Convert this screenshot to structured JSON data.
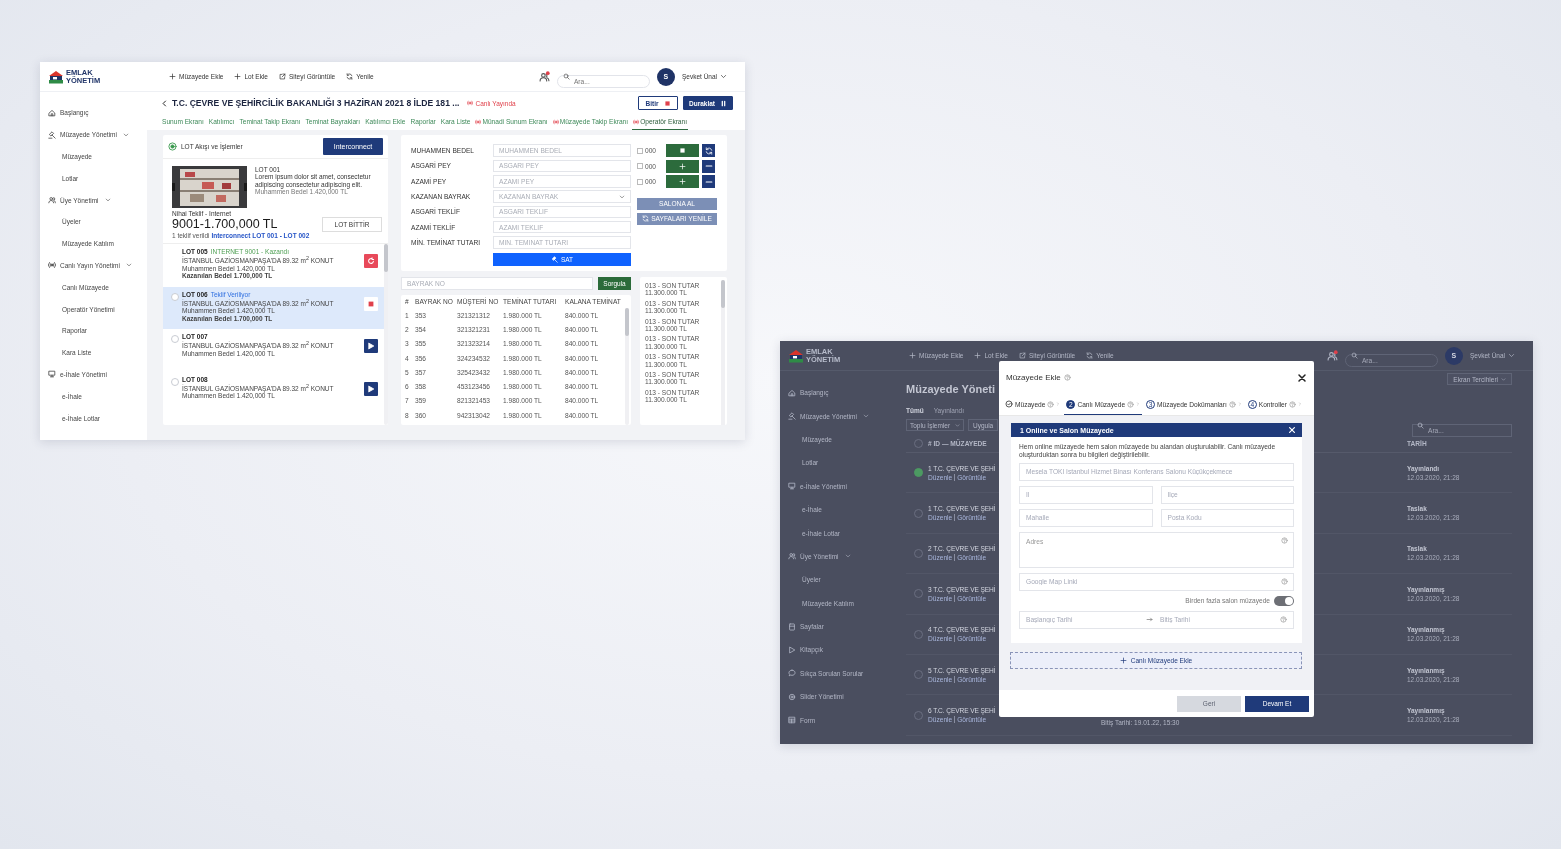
{
  "operator_screen": {
    "logo": {
      "line1": "EMLAK",
      "line2": "YÖNETİM"
    },
    "toolbar": [
      {
        "label": "Müzayede Ekle"
      },
      {
        "label": "Lot Ekle"
      },
      {
        "label": "Siteyi Görüntüle"
      },
      {
        "label": "Yenile"
      }
    ],
    "notifications": {
      "unread": true
    },
    "search": {
      "placeholder": "Ara..."
    },
    "user": {
      "initial": "S",
      "name": "Şevket Ünal"
    },
    "sidebar": [
      {
        "label": "Başlangıç"
      },
      {
        "label": "Müzayede Yönetimi",
        "expanded": true,
        "children": [
          {
            "label": "Müzayede"
          },
          {
            "label": "Lotlar"
          }
        ]
      },
      {
        "label": "Üye Yönetimi",
        "expanded": true,
        "children": [
          {
            "label": "Üyeler"
          },
          {
            "label": "Müzayede Katılım"
          }
        ]
      },
      {
        "label": "Canlı Yayın Yönetimi",
        "expanded": true,
        "children": [
          {
            "label": "Canlı Müzayede"
          },
          {
            "label": "Operatör Yönetimi"
          },
          {
            "label": "Raporlar"
          },
          {
            "label": "Kara Liste"
          }
        ]
      },
      {
        "label": "e-İhale Yönetimi",
        "children": [
          {
            "label": "e-İhale"
          },
          {
            "label": "e-İhale Lotlar"
          }
        ]
      }
    ],
    "title": "T.C. ÇEVRE VE ŞEHİRCİLİK BAKANLIĞI 3 HAZİRAN 2021 8 İLDE 181 ...",
    "live_badge": "Canlı Yayında",
    "actions": [
      {
        "label": "Bitir",
        "kind": "stop"
      },
      {
        "label": "Duraklat",
        "kind": "pause"
      }
    ],
    "tabs": [
      {
        "label": "Sunum Ekranı",
        "live": false,
        "selected": false
      },
      {
        "label": "Katılımcı",
        "live": false,
        "selected": false
      },
      {
        "label": "Teminat Takip Ekranı",
        "live": false,
        "selected": false
      },
      {
        "label": "Teminat Bayrakları",
        "live": false,
        "selected": false
      },
      {
        "label": "Katılımcı Ekle",
        "live": false,
        "selected": false
      },
      {
        "label": "Raporlar",
        "live": false,
        "selected": false
      },
      {
        "label": "Kara Liste",
        "live": false,
        "selected": false
      },
      {
        "label": "Münadi Sunum Ekranı",
        "live": true,
        "selected": false
      },
      {
        "label": "Müzayede Takip Ekranı",
        "live": true,
        "selected": false
      },
      {
        "label": "Operatör Ekranı",
        "live": true,
        "selected": true
      }
    ],
    "lot_panel": {
      "title": "LOT Akışı ve İşlemler",
      "button": "Interconnect",
      "current": {
        "lot": "LOT 001",
        "description": "Lorem ipsum dolor sit amet, consectetur adipiscing consectetur adipiscing elit.",
        "estimate": "Muhammen Bedel 1.420,000 TL",
        "final_label": "Nihai Teklif - Internet",
        "final_value": "9001-1.700,000 TL",
        "bids": "1 teklif verildi **Interconnect LOT 001 - LOT 002**",
        "finish_button": "LOT BİTTİR"
      },
      "lots": [
        {
          "lot": "LOT 005",
          "kind": "won",
          "status": "INTERNET 9001 - Kazandı",
          "selected": false,
          "address": "İSTANBUL GAZİOSMANPAŞA'DA 89.32 m$^{2}$ KONUT",
          "estimate": "Muhammen Bedel 1.420,000 TL",
          "won_price": "Kazanılan Bedel 1.700,000 TL"
        },
        {
          "lot": "LOT 006",
          "kind": "bidding",
          "status": "Teklif Veriliyor",
          "selected": true,
          "address": "İSTANBUL GAZİOSMANPAŞA'DA 89.32 m$^{2}$ KONUT",
          "estimate": "Muhammen Bedel 1.420,000 TL",
          "won_price": "Kazanılan Bedel 1.700,000 TL"
        },
        {
          "lot": "LOT 007",
          "kind": "pending",
          "selected": false,
          "address": "İSTANBUL GAZİOSMANPAŞA'DA 89.32 m$^{2}$ KONUT",
          "estimate": "Muhammen Bedel 1.420,000 TL"
        },
        {
          "lot": "LOT 008",
          "kind": "pending",
          "selected": false,
          "address": "İSTANBUL GAZİOSMANPAŞA'DA 89.32 m$^{2}$ KONUT",
          "estimate": "Muhammen Bedel 1.420,000 TL"
        }
      ]
    },
    "bid_form": {
      "fields": [
        {
          "label": "MUHAMMEN BEDEL",
          "kind": "text",
          "placeholder": "MUHAMMEN BEDEL"
        },
        {
          "label": "ASGARİ PEY",
          "kind": "text",
          "placeholder": "ASGARİ PEY"
        },
        {
          "label": "AZAMİ PEY",
          "kind": "text",
          "placeholder": "AZAMİ PEY"
        },
        {
          "label": "KAZANAN BAYRAK",
          "kind": "select",
          "placeholder": "KAZANAN BAYRAK"
        },
        {
          "label": "ASGARİ TEKLİF",
          "kind": "text",
          "placeholder": "ASGARİ TEKLİF"
        },
        {
          "label": "AZAMİ TEKLİF",
          "kind": "text",
          "placeholder": "AZAMİ TEKLİF"
        },
        {
          "label": "MİN. TEMİNAT TUTARI",
          "kind": "text",
          "placeholder": "MİN. TEMİNAT TUTARI"
        }
      ],
      "submit": "SAT",
      "controls": [
        {
          "label": "000",
          "checked": false
        },
        {
          "label": "000",
          "checked": false
        },
        {
          "label": "000",
          "checked": false
        }
      ],
      "buttons": [
        "SALONA AL",
        "SAYFALARI YENİLE"
      ]
    },
    "flag_search": {
      "placeholder": "BAYRAK NO",
      "button": "Sorgula"
    },
    "table": {
      "columns": [
        "#",
        "BAYRAK NO",
        "MÜŞTERİ NO",
        "TEMİNAT TUTARI",
        "KALANA TEMİNAT"
      ],
      "rows": [
        [
          "1",
          "353",
          "321321312",
          "1.980.000 TL",
          "840.000 TL"
        ],
        [
          "2",
          "354",
          "321321231",
          "1.980.000 TL",
          "840.000 TL"
        ],
        [
          "3",
          "355",
          "321323214",
          "1.980.000 TL",
          "840.000 TL"
        ],
        [
          "4",
          "356",
          "324234532",
          "1.980.000 TL",
          "840.000 TL"
        ],
        [
          "5",
          "357",
          "325423432",
          "1.980.000 TL",
          "840.000 TL"
        ],
        [
          "6",
          "358",
          "453123456",
          "1.980.000 TL",
          "840.000 TL"
        ],
        [
          "7",
          "359",
          "821321453",
          "1.980.000 TL",
          "840.000 TL"
        ],
        [
          "8",
          "360",
          "942313042",
          "1.980.000 TL",
          "840.000 TL"
        ]
      ]
    },
    "price_list": [
      {
        "label": "013 - SON TUTAR",
        "value": "11.300.000 TL"
      },
      {
        "label": "013 - SON TUTAR",
        "value": "11.300.000 TL"
      },
      {
        "label": "013 - SON TUTAR",
        "value": "11.300.000 TL"
      },
      {
        "label": "013 - SON TUTAR",
        "value": "11.300.000 TL"
      },
      {
        "label": "013 - SON TUTAR",
        "value": "11.300.000 TL"
      },
      {
        "label": "013 - SON TUTAR",
        "value": "11.300.000 TL"
      },
      {
        "label": "013 - SON TUTAR",
        "value": "11.300.000 TL"
      }
    ]
  },
  "auction_list_screen": {
    "logo": {
      "line1": "EMLAK",
      "line2": "YÖNETİM"
    },
    "toolbar": [
      {
        "label": "Müzayede Ekle"
      },
      {
        "label": "Lot Ekle"
      },
      {
        "label": "Siteyi Görüntüle"
      },
      {
        "label": "Yenile"
      }
    ],
    "notifications": {
      "unread": true
    },
    "search": {
      "placeholder": "Ara..."
    },
    "user": {
      "initial": "S",
      "name": "Şevket Ünal"
    },
    "sidebar": [
      {
        "label": "Başlangıç"
      },
      {
        "label": "Müzayede Yönetimi",
        "expanded": true,
        "children": [
          {
            "label": "Müzayede"
          },
          {
            "label": "Lotlar"
          }
        ]
      },
      {
        "label": "e-İhale Yönetimi",
        "children": [
          {
            "label": "e-İhale"
          },
          {
            "label": "e-İhale Lotlar"
          }
        ]
      },
      {
        "label": "Üye Yönetimi",
        "expanded": true,
        "children": [
          {
            "label": "Üyeler"
          },
          {
            "label": "Müzayede Katılım"
          }
        ]
      },
      {
        "label": "Sayfalar"
      },
      {
        "label": "Kitapçık"
      },
      {
        "label": "Sıkça Sorulan Sorular"
      },
      {
        "label": "Slider Yönetimi"
      },
      {
        "label": "Form"
      }
    ],
    "title": "Müzayede Yöneti",
    "view_button": "Ekran Tercihleri",
    "filters": [
      {
        "label": "Tümü",
        "selected": true
      },
      {
        "label": "Yayınlandı",
        "selected": false
      }
    ],
    "bulk_action": {
      "placeholder": "Toplu İşlemler"
    },
    "apply_button": "Uygula",
    "table_search": {
      "placeholder": "Ara..."
    },
    "select_all": {
      "checked": false
    },
    "columns": [
      "# ID — MÜZAYEDE",
      "TARİH"
    ],
    "rows": [
      {
        "number": "1",
        "title": "T.C. ÇEVRE VE ŞEHİ",
        "links": [
          "Düzenle",
          "Görüntüle"
        ],
        "status": "Yayınlandı",
        "date": "12.03.2020, 21:28",
        "selected": true
      },
      {
        "number": "1",
        "title": "T.C. ÇEVRE VE ŞEHİ",
        "links": [
          "Düzenle",
          "Görüntüle"
        ],
        "status": "Taslak",
        "date": "12.03.2020, 21:28",
        "selected": false
      },
      {
        "number": "2",
        "title": "T.C. ÇEVRE VE ŞEHİ",
        "links": [
          "Düzenle",
          "Görüntüle"
        ],
        "status": "Taslak",
        "date": "12.03.2020, 21:28",
        "selected": false
      },
      {
        "number": "3",
        "title": "T.C. ÇEVRE VE ŞEHİ",
        "links": [
          "Düzenle",
          "Görüntüle"
        ],
        "status": "Yayınlanmış",
        "date": "12.03.2020, 21:28",
        "selected": false
      },
      {
        "number": "4",
        "title": "T.C. ÇEVRE VE ŞEHİ",
        "links": [
          "Düzenle",
          "Görüntüle"
        ],
        "status": "Yayınlanmış",
        "date": "12.03.2020, 21:28",
        "selected": false
      },
      {
        "number": "5",
        "title": "T.C. ÇEVRE VE ŞEHİ",
        "links": [
          "Düzenle",
          "Görüntüle"
        ],
        "status": "Yayınlanmış",
        "date": "12.03.2020, 21:28",
        "selected": false
      },
      {
        "number": "6",
        "title": "T.C. ÇEVRE VE ŞEHİ",
        "links": [
          "Düzenle",
          "Görüntüle"
        ],
        "end_date": "Bitiş Tarihi: 19.01.22, 15:30",
        "status": "Yayınlanmış",
        "date": "12.03.2020, 21:28",
        "selected": false
      }
    ],
    "modal": {
      "title": "Müzayede Ekle",
      "steps": [
        {
          "label": "Müzayede",
          "done": true,
          "selected": false
        },
        {
          "number": "2",
          "label": "Canlı Müzayede",
          "done": false,
          "selected": true
        },
        {
          "number": "3",
          "label": "Müzayede Dokümanları",
          "done": false,
          "selected": false
        },
        {
          "number": "4",
          "label": "Kontroller",
          "done": false,
          "selected": false
        }
      ],
      "panel": {
        "title": "1 Online ve Salon Müzayede",
        "description": "Hem online müzayede hem salon müzayede bu alandan oluşturulabilir. Canlı müzayede oluşturduktan sonra bu bilgileri değiştirilebilir.",
        "fields": [
          {
            "kind": "text",
            "placeholder": "Mesela TOKİ İstanbul Hizmet Binası Konferans Salonu Küçükçekmece",
            "help": false
          },
          {
            "kind": "pair",
            "items": [
              {
                "placeholder": "İl"
              },
              {
                "placeholder": "İlçe"
              }
            ]
          },
          {
            "kind": "pair",
            "items": [
              {
                "placeholder": "Mahalle"
              },
              {
                "placeholder": "Posta Kodu"
              }
            ]
          },
          {
            "kind": "textarea",
            "placeholder": "Adres",
            "help": true
          },
          {
            "kind": "text",
            "placeholder": "Google Map Linki",
            "help": true
          },
          {
            "kind": "toggle",
            "label": "Birden fazla salon müzayede",
            "on": true
          },
          {
            "kind": "daterange",
            "start_placeholder": "Başlangıç Tarihi",
            "end_placeholder": "Bitiş Tarihi",
            "help": true
          }
        ]
      },
      "add_button": "Canlı Müzayede Ekle",
      "back_button": {
        "label": "Geri",
        "disabled": true
      },
      "next_button": "Devam Et"
    }
  }
}
